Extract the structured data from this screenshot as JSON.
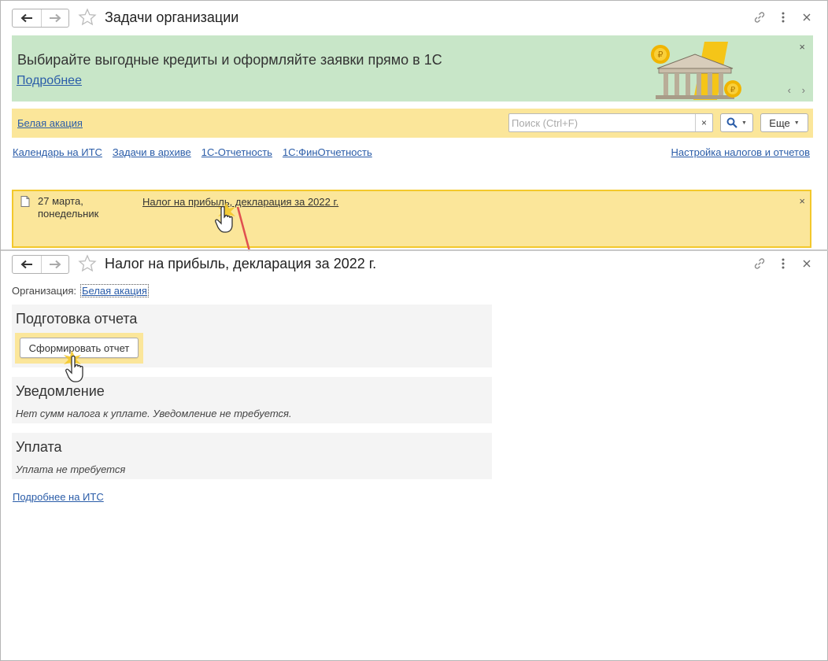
{
  "top_window": {
    "title": "Задачи организации",
    "banner": {
      "title": "Выбирайте выгодные кредиты и оформляйте заявки прямо в 1С",
      "more": "Подробнее",
      "close": "×",
      "prev": "‹",
      "next": "›",
      "color": "#c8e6c8"
    },
    "org_bar": {
      "org_link": "Белая акация",
      "search_placeholder": "Поиск (Ctrl+F)",
      "search_clear": "×",
      "more_label": "Еще",
      "color": "#fbe69a"
    },
    "links": [
      "Календарь на ИТС",
      "Задачи в архиве",
      "1С-Отчетность",
      "1С:ФинОтчетность"
    ],
    "settings_link": "Настройка налогов и отчетов",
    "task": {
      "date_line1": "27 марта,",
      "date_line2": "понедельник",
      "title": "Налог на прибыль, декларация за 2022 г.",
      "close": "×"
    }
  },
  "bottom_window": {
    "title": "Налог на прибыль, декларация за 2022 г.",
    "org_label": "Организация:",
    "org_value": "Белая акация",
    "sections": [
      {
        "title": "Подготовка отчета",
        "button": "Сформировать отчет"
      },
      {
        "title": "Уведомление",
        "note": "Нет сумм налога к уплате. Уведомление не требуется."
      },
      {
        "title": "Уплата",
        "note": "Уплата не требуется"
      }
    ],
    "its_link": "Подробнее на ИТС"
  },
  "icons": {
    "back": "arrow-left-icon",
    "forward": "arrow-right-icon",
    "star": "star-icon",
    "link": "link-icon",
    "menu": "more-vertical-icon",
    "close": "close-icon",
    "search": "search-icon",
    "doc": "document-icon",
    "hand": "hand-pointer-icon",
    "bank": "bank-building-icon"
  },
  "colors": {
    "link": "#2a5ca8",
    "highlight_border": "#f3c82b",
    "pointer_line": "#e05050"
  }
}
